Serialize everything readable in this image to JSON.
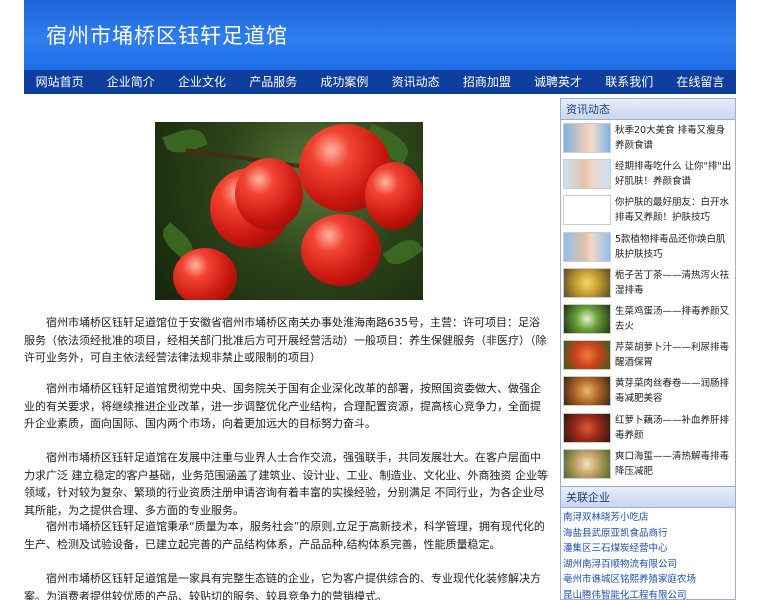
{
  "header": {
    "title": "宿州市埇桥区钰轩足道馆"
  },
  "nav": {
    "items": [
      "网站首页",
      "企业简介",
      "企业文化",
      "产品服务",
      "成功案例",
      "资讯动态",
      "招商加盟",
      "诚聘英才",
      "联系我们",
      "在线留言"
    ]
  },
  "main": {
    "paragraphs": [
      "宿州市埇桥区钰轩足道馆位于安徽省宿州市埇桥区南关办事处淮海南路635号，主营：许可项目：足浴服务（依法须经批准的项目，经相关部门批准后方可开展经营活动）一般项目：养生保健服务（非医疗）（除许可业务外，可自主依法经营法律法规非禁止或限制的项目）",
      "宿州市埇桥区钰轩足道馆贯彻党中央、国务院关于国有企业深化改革的部署，按照国资委做大、做强企业的有关要求，将继续推进企业改革，进一步调整优化产业结构，合理配置资源，提高核心竞争力，全面提升企业素质，面向国际、国内两个市场，向着更加远大的目标努力奋斗。",
      "宿州市埇桥区钰轩足道馆在发展中注重与业界人士合作交流，强强联手，共同发展壮大。在客户层面中力求广泛 建立稳定的客户基础，业务范围涵盖了建筑业、设计业、工业、制造业、文化业、外商独资 企业等领域，针对较为复杂、繁琐的行业资质注册申请咨询有着丰富的实操经验，分别满足 不同行业，为各企业尽其所能，为之提供合理、多方面的专业服务。",
      "宿州市埇桥区钰轩足道馆秉承“质量为本，服务社会”的原则,立足于高新技术，科学管理，拥有现代化的生产、检测及试验设备，已建立起完善的产品结构体系，产品品种,结构体系完善，性能质量稳定。",
      "宿州市埇桥区钰轩足道馆是一家具有完整生态链的企业，它为客户提供综合的、专业现代化装修解决方案。为消费者提供较优质的产品、较贴切的服务、较具竞争力的营销模式。"
    ]
  },
  "sidebar": {
    "news_title": "资讯动态",
    "news": [
      {
        "text": "秋季20大美食 排毒又瘦身养颜食谱",
        "thumb": "face-photo"
      },
      {
        "text": "经期排毒吃什么 让你\"排\"出好肌肤！养颜食谱",
        "thumb": "face-photo"
      },
      {
        "text": "你护肤的最好朋友：白开水排毒又养颜！护肤技巧",
        "thumb": "blank"
      },
      {
        "text": "5款植物排毒品还你焕白肌肤护肤技巧",
        "thumb": "face-photo"
      },
      {
        "text": "栀子苦丁茶——清热泻火祛湿排毒",
        "thumb": "food-photo"
      },
      {
        "text": "生菜鸡蛋汤——排毒养颜又去火",
        "thumb": "food-photo"
      },
      {
        "text": "芹菜胡萝卜汁——利尿排毒醒酒保胃",
        "thumb": "food-photo"
      },
      {
        "text": "黄芽菜肉丝春卷——润肠排毒减肥美容",
        "thumb": "food-photo"
      },
      {
        "text": "红萝卜藕汤——补血养肝排毒养颜",
        "thumb": "food-photo"
      },
      {
        "text": "爽口海蜇——清热解毒排毒降压减肥",
        "thumb": "food-photo"
      }
    ],
    "links_title": "关联企业",
    "links": [
      "南浔双林晓芳小吃店",
      "海盐县武原亚凯食品商行",
      "潘集区三石煤炭经营中心",
      "湖州南浔百顺物流有限公司",
      "亳州市谯城区铭熙养殖家庭农场",
      "昆山腾伟智能化工程有限公司"
    ]
  },
  "colors": {
    "header_blue": "#1d64d8",
    "nav_blue": "#0f3f9e",
    "link_blue": "#1a4fb0"
  }
}
